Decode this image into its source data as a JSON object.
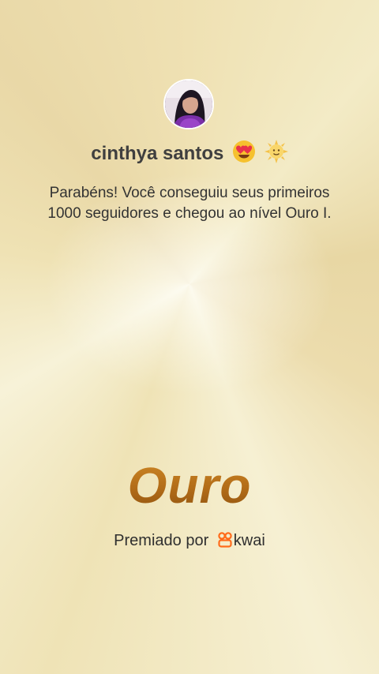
{
  "profile": {
    "username": "cinthya santos"
  },
  "message": "Parabéns! Você conseguiu seus primeiros 1000 seguidores e chegou ao nível Ouro I.",
  "level": "Ouro",
  "footer": {
    "awarded_by": "Premiado por",
    "brand": "kwai"
  },
  "icons": {
    "emoji_1": "heart-eyes-emoji-icon",
    "emoji_2": "smiling-sun-emoji-icon",
    "brand_logo": "kwai-logo-icon"
  },
  "colors": {
    "level_text": "#b0701d",
    "brand_logo": "#ff6b1a"
  }
}
